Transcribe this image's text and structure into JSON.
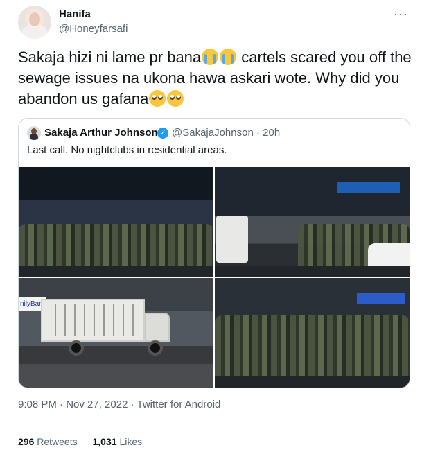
{
  "author": {
    "name": "Hanifa",
    "handle": "@Honeyfarsafi"
  },
  "more_label": "···",
  "tweet": {
    "text_1": "Sakaja hizi ni lame pr bana",
    "text_2": " cartels scared you off the sewage issues na ukona hawa askari wote. Why did you abandon us gafana",
    "emojis": [
      "loudly-crying-face-icon",
      "face-with-rolling-eyes-icon"
    ]
  },
  "quote": {
    "name": "Sakaja Arthur Johnson",
    "verified_symbol": "✓",
    "handle": "@SakajaJohnson · 20h",
    "text": "Last call. No nightclubs in residential areas.",
    "photo_bank_sign": "nilyBank"
  },
  "meta": {
    "timestamp": "9:08 PM · Nov 27, 2022 · Twitter for Android"
  },
  "stats": {
    "retweets_count": "296",
    "retweets_label": "Retweets",
    "likes_count": "1,031",
    "likes_label": "Likes"
  },
  "colors": {
    "text": "#0f1419",
    "secondary": "#536471",
    "verified": "#1d9bf0",
    "border": "#cfd9de"
  }
}
